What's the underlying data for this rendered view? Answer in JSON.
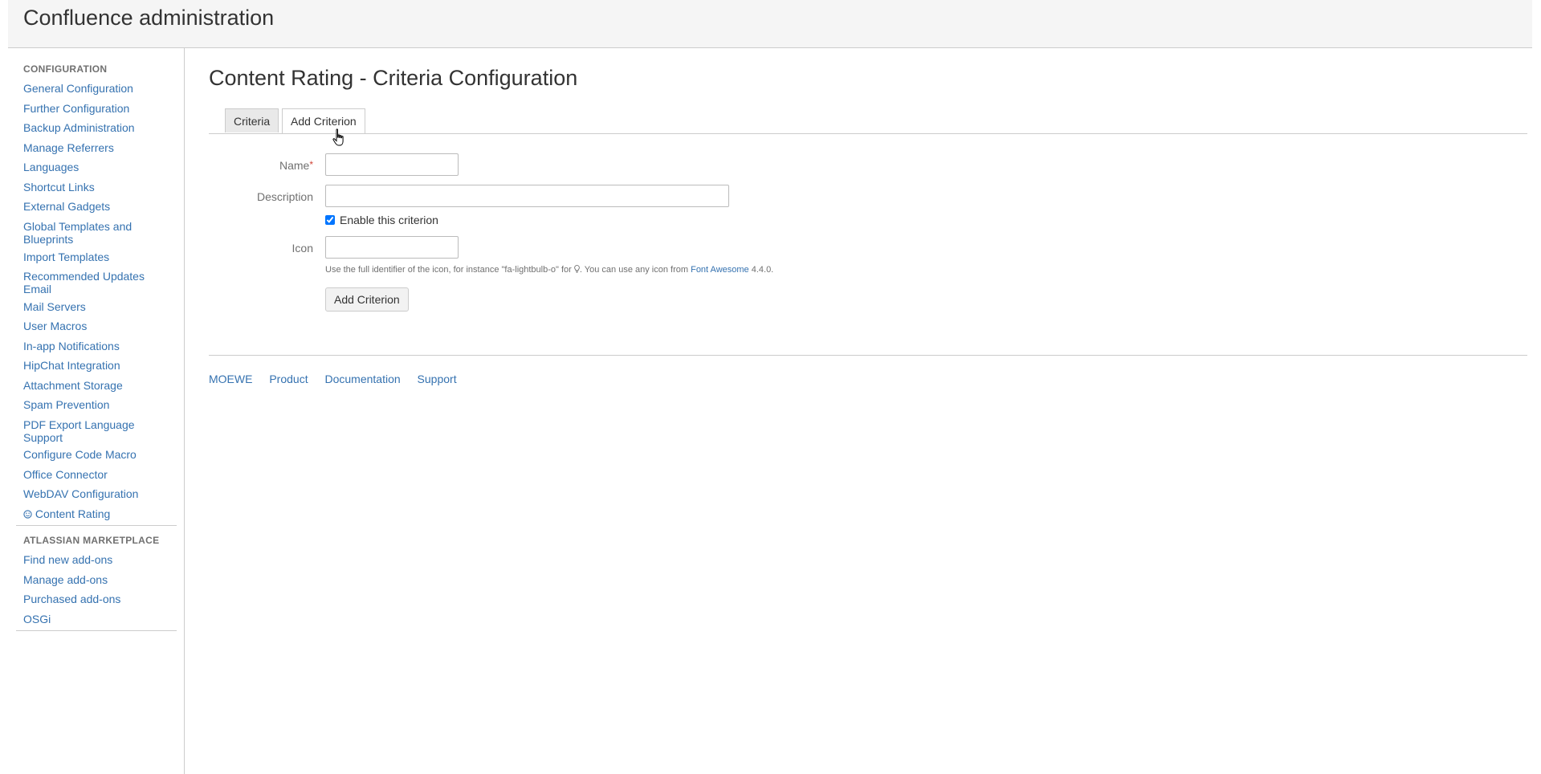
{
  "header": {
    "title": "Confluence administration"
  },
  "sidebar": {
    "configuration_title": "CONFIGURATION",
    "configuration_items": [
      "General Configuration",
      "Further Configuration",
      "Backup Administration",
      "Manage Referrers",
      "Languages",
      "Shortcut Links",
      "External Gadgets",
      "Global Templates and Blueprints",
      "Import Templates",
      "Recommended Updates Email",
      "Mail Servers",
      "User Macros",
      "In-app Notifications",
      "HipChat Integration",
      "Attachment Storage",
      "Spam Prevention",
      "PDF Export Language Support",
      "Configure Code Macro",
      "Office Connector",
      "WebDAV Configuration",
      "Content Rating"
    ],
    "content_rating_icon": "smiley-icon",
    "marketplace_title": "ATLASSIAN MARKETPLACE",
    "marketplace_items": [
      "Find new add-ons",
      "Manage add-ons",
      "Purchased add-ons",
      "OSGi"
    ]
  },
  "main": {
    "page_title": "Content Rating - Criteria Configuration",
    "tabs": [
      {
        "label": "Criteria",
        "active": false
      },
      {
        "label": "Add Criterion",
        "active": true
      }
    ],
    "form": {
      "name_label": "Name",
      "name_required_marker": "*",
      "name_value": "",
      "description_label": "Description",
      "description_value": "",
      "enable_label": "Enable this criterion",
      "enable_checked": true,
      "icon_label": "Icon",
      "icon_value": "",
      "hint_prefix": "Use the full identifier of the icon, for instance \"fa-lightbulb-o\" for",
      "hint_icon": "lightbulb-icon",
      "hint_middle": ". You can use any icon from",
      "hint_link": "Font Awesome",
      "hint_suffix": "4.4.0.",
      "submit_label": "Add Criterion"
    }
  },
  "footer": {
    "links": [
      "MOEWE",
      "Product",
      "Documentation",
      "Support"
    ]
  },
  "colors": {
    "link": "#3572b0",
    "header_bg": "#f5f5f5",
    "required": "#d04437"
  }
}
